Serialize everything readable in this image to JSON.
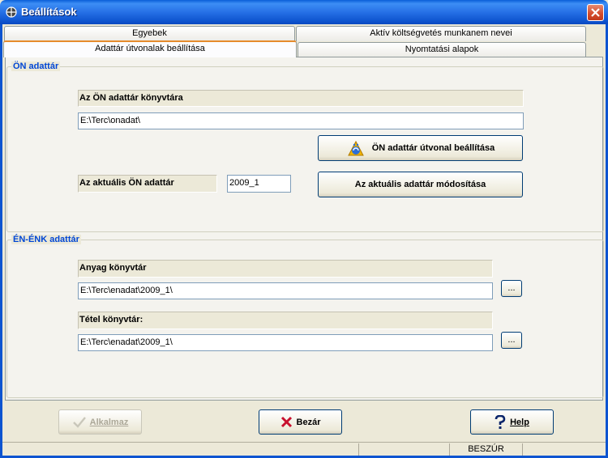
{
  "window": {
    "title": "Beállítások"
  },
  "tabs": {
    "egyebek": "Egyebek",
    "aktiv": "Aktív költségvetés munkanem nevei",
    "adattar": "Adattár útvonalak beállítása",
    "nyomtatasi": "Nyomtatási alapok"
  },
  "on_group": {
    "title": "ÖN adattár",
    "dir_label": "Az ÖN adattár könyvtára",
    "dir_value": "E:\\Terc\\onadat\\",
    "set_path_button": "ÖN adattár útvonal beállítása",
    "current_label": "Az aktuális ÖN adattár",
    "current_value": "2009_1",
    "modify_button": "Az aktuális adattár módosítása"
  },
  "en_group": {
    "title": "ÉN-ÉNK adattár",
    "anyag_label": "Anyag könyvtár",
    "anyag_value": "E:\\Terc\\enadat\\2009_1\\",
    "tetel_label": "Tétel könyvtár:",
    "tetel_value": "E:\\Terc\\enadat\\2009_1\\",
    "browse_label": "..."
  },
  "buttons": {
    "apply": "Alkalmaz",
    "close": "Bezár",
    "help": "Help"
  },
  "status_bar": {
    "mode": "BESZÚR"
  },
  "colors": {
    "title_bar": "#0a5fd8",
    "group_title": "#0046d5",
    "close_x": "#c8102e",
    "apply_disabled": "#aca899"
  }
}
